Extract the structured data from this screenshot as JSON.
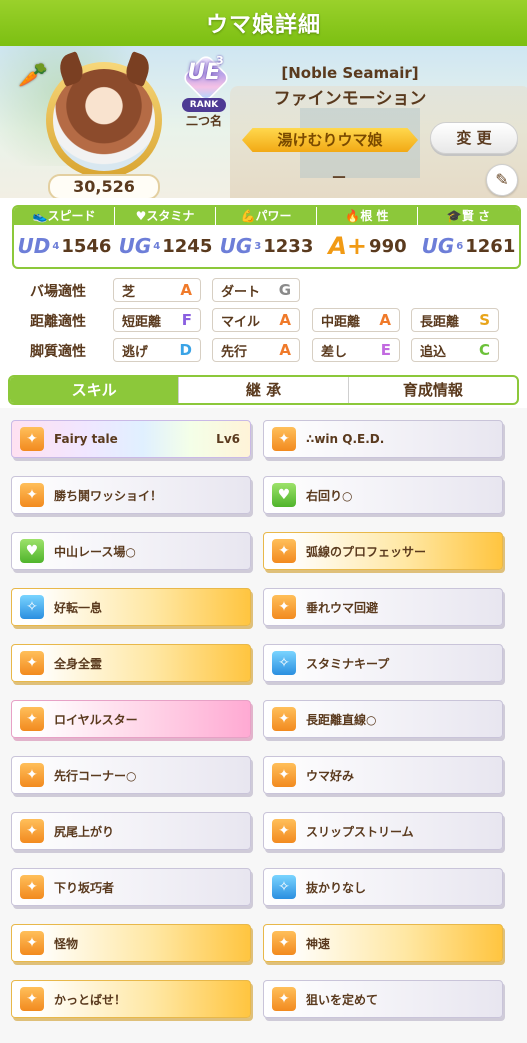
{
  "header": {
    "title": "ウマ娘詳細"
  },
  "profile": {
    "rank_main": "UE",
    "rank_sup": "3",
    "rank_label": "RANK",
    "nickname": "二つ名",
    "score": "30,526",
    "costume": "[Noble Seamair]",
    "name": "ファインモーション",
    "title_banner": "湯けむりウマ娘",
    "change_label": "変 更",
    "subtitle": "－",
    "carrot_icon": "carrot-icon",
    "edit_icon": "pencil-icon"
  },
  "stats": [
    {
      "label": "スピード",
      "grade": "UD",
      "sub": "4",
      "value": "1546"
    },
    {
      "label": "スタミナ",
      "grade": "UG",
      "sub": "4",
      "value": "1245"
    },
    {
      "label": "パワー",
      "grade": "UG",
      "sub": "3",
      "value": "1233"
    },
    {
      "label": "根 性",
      "grade": "A+",
      "sub": "",
      "value": "990"
    },
    {
      "label": "賢 さ",
      "grade": "UG",
      "sub": "6",
      "value": "1261"
    }
  ],
  "aptitude": {
    "track_label": "バ場適性",
    "distance_label": "距離適性",
    "style_label": "脚質適性",
    "track": [
      {
        "name": "芝",
        "grade": "A"
      },
      {
        "name": "ダート",
        "grade": "G"
      }
    ],
    "distance": [
      {
        "name": "短距離",
        "grade": "F"
      },
      {
        "name": "マイル",
        "grade": "A"
      },
      {
        "name": "中距離",
        "grade": "A"
      },
      {
        "name": "長距離",
        "grade": "S"
      }
    ],
    "style": [
      {
        "name": "逃げ",
        "grade": "D"
      },
      {
        "name": "先行",
        "grade": "A"
      },
      {
        "name": "差し",
        "grade": "E"
      },
      {
        "name": "追込",
        "grade": "C"
      }
    ],
    "grade_colors": {
      "A": "#f07a2a",
      "G": "#8a8a8a",
      "F": "#8a5fe0",
      "S": "#e8a41a",
      "D": "#3aa3e6",
      "E": "#c26ae0",
      "C": "#6cc13a"
    }
  },
  "tabs": [
    {
      "label": "スキル",
      "active": true
    },
    {
      "label": "継 承",
      "active": false
    },
    {
      "label": "育成情報",
      "active": false
    }
  ],
  "skills": [
    {
      "name": "Fairy tale",
      "level": "Lv6",
      "style": "rainbow",
      "icon": "orange"
    },
    {
      "name": "∴win Q.E.D.",
      "level": "",
      "style": "plain",
      "icon": "orange"
    },
    {
      "name": "勝ち鬨ワッショイ！",
      "level": "",
      "style": "plain",
      "icon": "orange"
    },
    {
      "name": "右回り○",
      "level": "",
      "style": "plain",
      "icon": "green"
    },
    {
      "name": "中山レース場○",
      "level": "",
      "style": "plain",
      "icon": "green"
    },
    {
      "name": "弧線のプロフェッサー",
      "level": "",
      "style": "gold",
      "icon": "orange"
    },
    {
      "name": "好転一息",
      "level": "",
      "style": "gold",
      "icon": "blue"
    },
    {
      "name": "垂れウマ回避",
      "level": "",
      "style": "plain",
      "icon": "orange"
    },
    {
      "name": "全身全霊",
      "level": "",
      "style": "gold",
      "icon": "orange"
    },
    {
      "name": "スタミナキープ",
      "level": "",
      "style": "plain",
      "icon": "blue"
    },
    {
      "name": "ロイヤルスター",
      "level": "",
      "style": "pink",
      "icon": "orange"
    },
    {
      "name": "長距離直線○",
      "level": "",
      "style": "plain",
      "icon": "orange"
    },
    {
      "name": "先行コーナー○",
      "level": "",
      "style": "plain",
      "icon": "orange"
    },
    {
      "name": "ウマ好み",
      "level": "",
      "style": "plain",
      "icon": "orange"
    },
    {
      "name": "尻尾上がり",
      "level": "",
      "style": "plain",
      "icon": "orange"
    },
    {
      "name": "スリップストリーム",
      "level": "",
      "style": "plain",
      "icon": "orange"
    },
    {
      "name": "下り坂巧者",
      "level": "",
      "style": "plain",
      "icon": "orange"
    },
    {
      "name": "抜かりなし",
      "level": "",
      "style": "plain",
      "icon": "blue"
    },
    {
      "name": "怪物",
      "level": "",
      "style": "gold",
      "icon": "orange"
    },
    {
      "name": "神速",
      "level": "",
      "style": "gold",
      "icon": "orange"
    },
    {
      "name": "かっとばせ！",
      "level": "",
      "style": "gold",
      "icon": "orange"
    },
    {
      "name": "狙いを定めて",
      "level": "",
      "style": "plain",
      "icon": "orange"
    }
  ]
}
